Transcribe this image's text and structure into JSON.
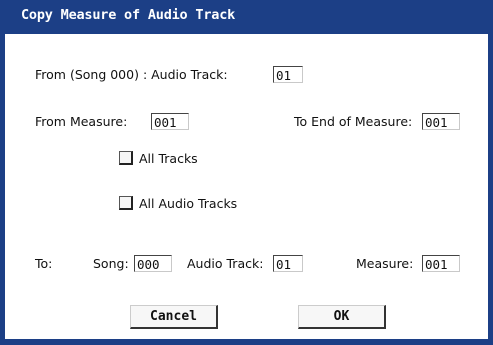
{
  "dialog": {
    "title": "Copy Measure of Audio Track",
    "colors": {
      "frame": "#1c3f86",
      "background": "#ffffff"
    }
  },
  "from": {
    "song_label": "From (Song 000) : Audio Track:",
    "audio_track_value": "01",
    "measure_label": "From Measure:",
    "measure_value": "001",
    "end_measure_label": "To End of Measure:",
    "end_measure_value": "001"
  },
  "options": {
    "all_tracks_label": "All Tracks",
    "all_tracks_checked": false,
    "all_audio_tracks_label": "All Audio Tracks",
    "all_audio_tracks_checked": false
  },
  "to": {
    "label": "To:",
    "song_label": "Song:",
    "song_value": "000",
    "audio_track_label": "Audio Track:",
    "audio_track_value": "01",
    "measure_label": "Measure:",
    "measure_value": "001"
  },
  "buttons": {
    "cancel_label": "Cancel",
    "ok_label": "OK"
  }
}
